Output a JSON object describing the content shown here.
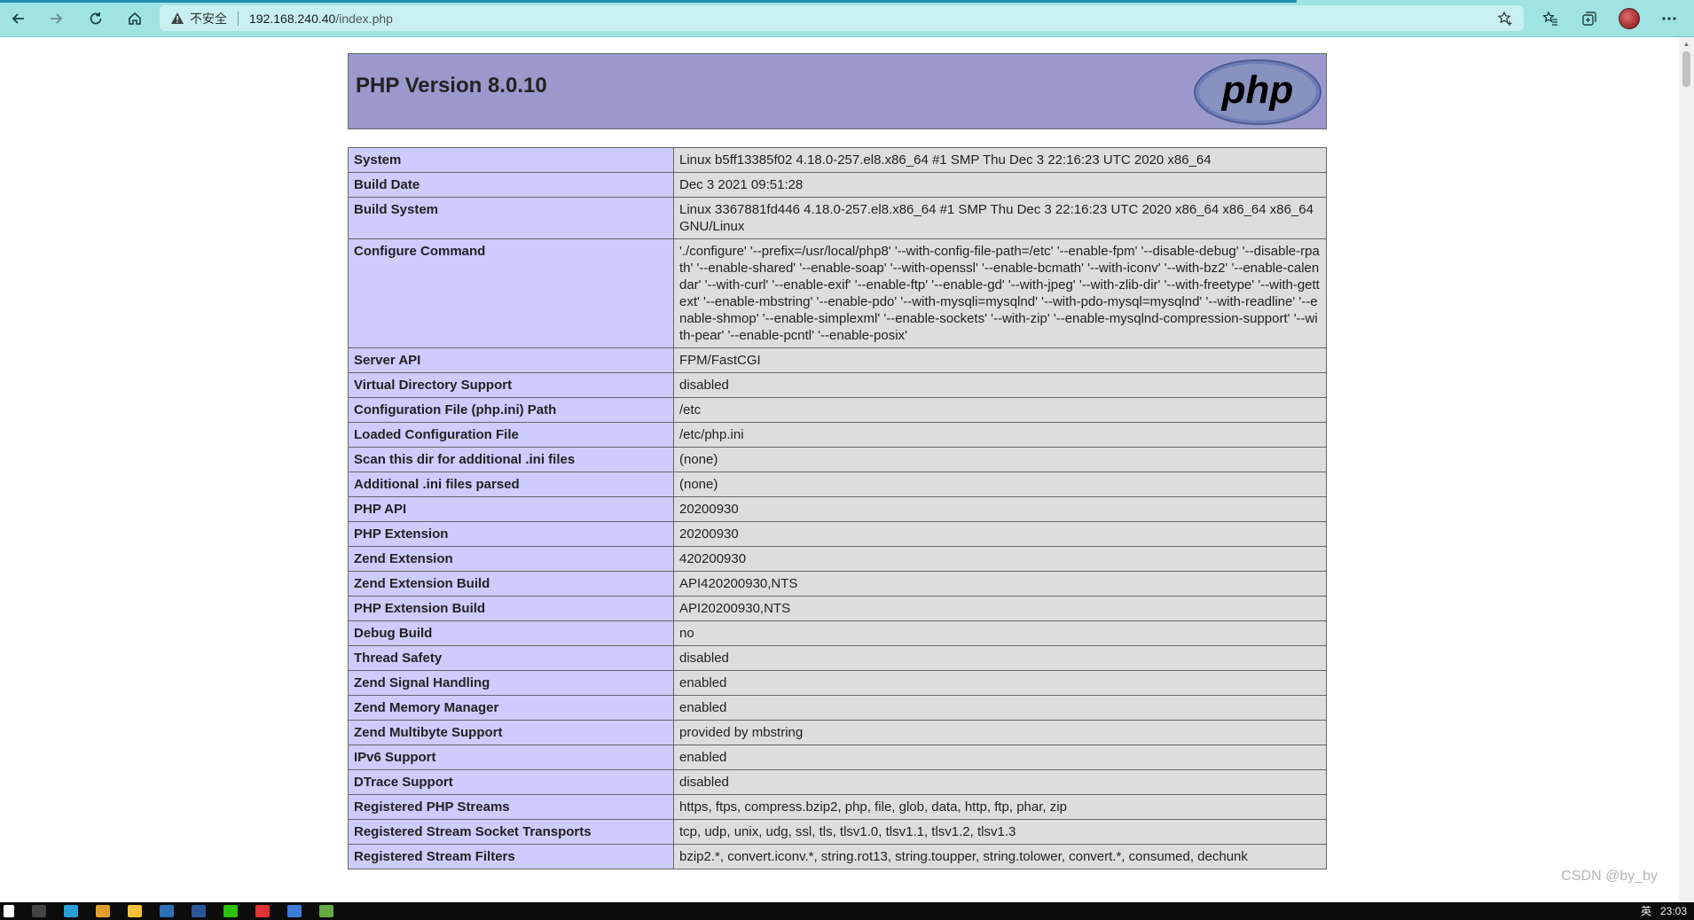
{
  "browser": {
    "security_label": "不安全",
    "url_host": "192.168.240.40",
    "url_path": "/index.php"
  },
  "header": {
    "title": "PHP Version 8.0.10",
    "logo_text": "php"
  },
  "info_rows": [
    {
      "key": "System",
      "value": "Linux b5ff13385f02 4.18.0-257.el8.x86_64 #1 SMP Thu Dec 3 22:16:23 UTC 2020 x86_64"
    },
    {
      "key": "Build Date",
      "value": "Dec 3 2021 09:51:28"
    },
    {
      "key": "Build System",
      "value": "Linux 3367881fd446 4.18.0-257.el8.x86_64 #1 SMP Thu Dec 3 22:16:23 UTC 2020 x86_64 x86_64 x86_64 GNU/Linux"
    },
    {
      "key": "Configure Command",
      "value": "'./configure' '--prefix=/usr/local/php8' '--with-config-file-path=/etc' '--enable-fpm' '--disable-debug' '--disable-rpath' '--enable-shared' '--enable-soap' '--with-openssl' '--enable-bcmath' '--with-iconv' '--with-bz2' '--enable-calendar' '--with-curl' '--enable-exif' '--enable-ftp' '--enable-gd' '--with-jpeg' '--with-zlib-dir' '--with-freetype' '--with-gettext' '--enable-mbstring' '--enable-pdo' '--with-mysqli=mysqlnd' '--with-pdo-mysql=mysqlnd' '--with-readline' '--enable-shmop' '--enable-simplexml' '--enable-sockets' '--with-zip' '--enable-mysqlnd-compression-support' '--with-pear' '--enable-pcntl' '--enable-posix'"
    },
    {
      "key": "Server API",
      "value": "FPM/FastCGI"
    },
    {
      "key": "Virtual Directory Support",
      "value": "disabled"
    },
    {
      "key": "Configuration File (php.ini) Path",
      "value": "/etc"
    },
    {
      "key": "Loaded Configuration File",
      "value": "/etc/php.ini"
    },
    {
      "key": "Scan this dir for additional .ini files",
      "value": "(none)"
    },
    {
      "key": "Additional .ini files parsed",
      "value": "(none)"
    },
    {
      "key": "PHP API",
      "value": "20200930"
    },
    {
      "key": "PHP Extension",
      "value": "20200930"
    },
    {
      "key": "Zend Extension",
      "value": "420200930"
    },
    {
      "key": "Zend Extension Build",
      "value": "API420200930,NTS"
    },
    {
      "key": "PHP Extension Build",
      "value": "API20200930,NTS"
    },
    {
      "key": "Debug Build",
      "value": "no"
    },
    {
      "key": "Thread Safety",
      "value": "disabled"
    },
    {
      "key": "Zend Signal Handling",
      "value": "enabled"
    },
    {
      "key": "Zend Memory Manager",
      "value": "enabled"
    },
    {
      "key": "Zend Multibyte Support",
      "value": "provided by mbstring"
    },
    {
      "key": "IPv6 Support",
      "value": "enabled"
    },
    {
      "key": "DTrace Support",
      "value": "disabled"
    },
    {
      "key": "Registered PHP Streams",
      "value": "https, ftps, compress.bzip2, php, file, glob, data, http, ftp, phar, zip"
    },
    {
      "key": "Registered Stream Socket Transports",
      "value": "tcp, udp, unix, udg, ssl, tls, tlsv1.0, tlsv1.1, tlsv1.2, tlsv1.3"
    },
    {
      "key": "Registered Stream Filters",
      "value": "bzip2.*, convert.iconv.*, string.rot13, string.toupper, string.tolower, convert.*, consumed, dechunk"
    }
  ],
  "watermark": "CSDN @by_by",
  "taskbar": {
    "clock": "23:03",
    "ime": "英"
  }
}
